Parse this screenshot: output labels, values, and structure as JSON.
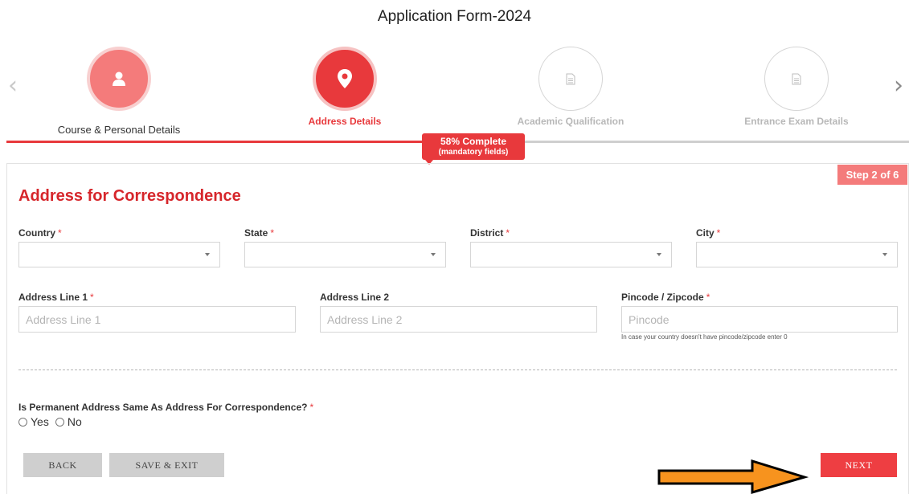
{
  "header": {
    "title": "Application Form-2024"
  },
  "steps": [
    {
      "label": "Course & Personal Details",
      "state": "done",
      "icon": "user-icon"
    },
    {
      "label": "Address Details",
      "state": "active",
      "icon": "map-pin-icon"
    },
    {
      "label": "Academic Qualification",
      "state": "todo",
      "icon": "document-icon"
    },
    {
      "label": "Entrance Exam Details",
      "state": "todo",
      "icon": "document-icon"
    }
  ],
  "progress": {
    "percent": 58,
    "text": "58% Complete",
    "subtext": "(mandatory fields)"
  },
  "step_indicator": "Step 2 of 6",
  "section": {
    "title": "Address for Correspondence"
  },
  "fields": {
    "country": {
      "label": "Country",
      "required": "*"
    },
    "state": {
      "label": "State",
      "required": "*"
    },
    "district": {
      "label": "District",
      "required": "*"
    },
    "city": {
      "label": "City",
      "required": "*"
    },
    "address1": {
      "label": "Address Line 1",
      "required": "*",
      "placeholder": "Address Line 1"
    },
    "address2": {
      "label": "Address Line 2",
      "placeholder": "Address Line 2"
    },
    "pincode": {
      "label": "Pincode / Zipcode",
      "required": "*",
      "placeholder": "Pincode",
      "hint": "In case your country doesn't have pincode/zipcode enter 0"
    }
  },
  "permanent": {
    "question": "Is Permanent Address Same As Address For Correspondence?",
    "required": "*",
    "options": [
      "Yes",
      "No"
    ]
  },
  "buttons": {
    "back": "BACK",
    "save_exit": "SAVE & EXIT",
    "next": "NEXT"
  },
  "colors": {
    "accent": "#e8393c",
    "accent_light": "#f47b7b",
    "annotation_arrow": "#f7931e"
  }
}
